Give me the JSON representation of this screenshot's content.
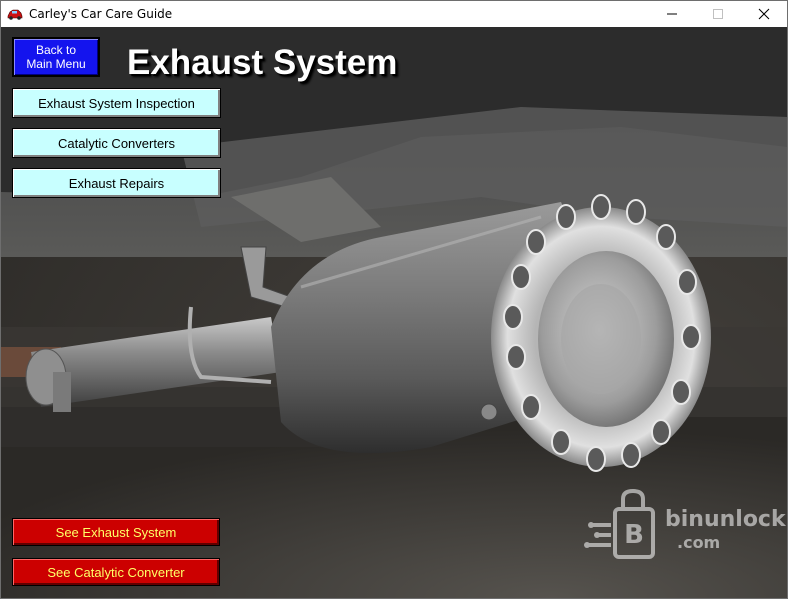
{
  "window": {
    "title": "Carley's Car Care Guide",
    "controls": {
      "minimize": "—",
      "maximize": "☐",
      "close": "✕"
    }
  },
  "page": {
    "heading": "Exhaust System"
  },
  "buttons": {
    "back": "Back to\nMain Menu",
    "inspection": "Exhaust System Inspection",
    "catalytic": "Catalytic Converters",
    "repairs": "Exhaust Repairs",
    "see_exhaust": "See Exhaust System",
    "see_catalytic": "See Catalytic Converter"
  },
  "watermark": {
    "line1": "binunlock",
    "line2": ".com"
  },
  "colors": {
    "back_button": "#1414ee",
    "menu_buttons": "#c8ffff",
    "photo_buttons": "#cc0000",
    "photo_button_text": "#ffff66"
  },
  "photo_description_icon": "exhaust-pipe-photo"
}
